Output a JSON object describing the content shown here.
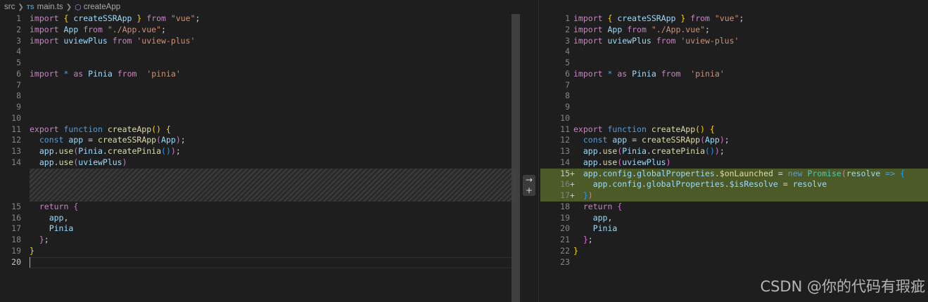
{
  "breadcrumb": {
    "folder": "src",
    "file_badge": "TS",
    "file": "main.ts",
    "symbol": "createApp"
  },
  "left": {
    "line_numbers": [
      "1",
      "2",
      "3",
      "4",
      "5",
      "6",
      "7",
      "8",
      "9",
      "10",
      "11",
      "12",
      "13",
      "14",
      "15",
      "16",
      "17",
      "18",
      "19",
      "20"
    ],
    "active_line": "20"
  },
  "right": {
    "line_numbers": [
      "1",
      "2",
      "3",
      "4",
      "5",
      "6",
      "7",
      "8",
      "9",
      "10",
      "11",
      "12",
      "13",
      "14",
      "15",
      "16",
      "17",
      "18",
      "19",
      "20",
      "21",
      "22",
      "23"
    ],
    "added_marker": "+",
    "active_line": "15"
  },
  "code": {
    "import": "import",
    "from": "from",
    "as": "as",
    "star": "*",
    "export": "export",
    "function": "function",
    "const": "const",
    "return": "return",
    "new": "new",
    "createSSRApp": "createSSRApp",
    "vue": "\"vue\"",
    "App": "App",
    "app_vue": "\"./App.vue\"",
    "uviewPlus": "uviewPlus",
    "uview_plus": "'uview-plus'",
    "Pinia": "Pinia",
    "pinia": "'pinia'",
    "createApp": "createApp",
    "app": "app",
    "use": "use",
    "createPinia": "createPinia",
    "config": "config",
    "globalProperties": "globalProperties",
    "onLaunched": "$onLaunched",
    "isResolve": "$isResolve",
    "Promise": "Promise",
    "resolve": "resolve",
    "arrow": "=>"
  },
  "diff_action_icons": [
    "arrow-right-icon",
    "plus-icon"
  ],
  "watermark": "CSDN @你的代码有瑕疵"
}
